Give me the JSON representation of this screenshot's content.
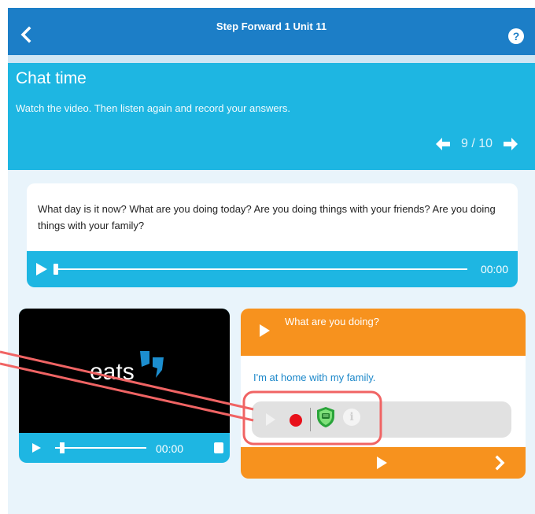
{
  "topbar": {
    "title": "Step Forward 1 Unit 11",
    "help_label": "?"
  },
  "header": {
    "title": "Chat time",
    "instruction": "Watch the video. Then listen again and record your answers.",
    "page_indicator": "9 / 10"
  },
  "question_card": {
    "text": "What day is it now? What are you doing today? Are you doing things with your friends? Are you doing things with your family?",
    "audio_time": "00:00",
    "audio_progress": 0
  },
  "video": {
    "time": "00:00",
    "logo_text": "eats",
    "progress": 0
  },
  "answer_card": {
    "prompt": "What are you doing?",
    "answer": "I'm at home with my family.",
    "info_label": "i"
  },
  "colors": {
    "topbar": "#1c7ec7",
    "header": "#1eb6e2",
    "orange": "#f7921e",
    "answer_text": "#1b87c9",
    "record": "#e8101a",
    "highlight": "#f06464",
    "background": "#e9f4fb"
  },
  "icons": {
    "back": "chevron-left-icon",
    "help": "question-mark-icon",
    "prev": "arrow-left-icon",
    "next": "arrow-right-icon",
    "play": "play-icon",
    "record": "record-icon",
    "shield": "shield-icon",
    "info": "info-icon",
    "fullscreen": "fullscreen-icon",
    "next_chevron": "chevron-right-icon"
  }
}
